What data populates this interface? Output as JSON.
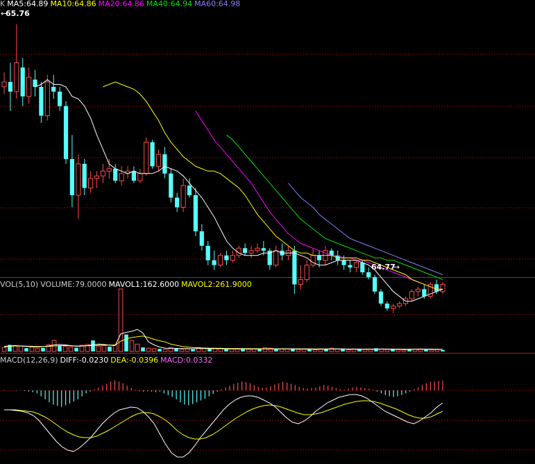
{
  "header": {
    "main_prefix": "K",
    "ma5": "MA5:64.89",
    "ma10": "MA10:64.86",
    "ma20": "MA20:64.86",
    "ma40": "MA40:64.94",
    "ma60": "MA60:64.98",
    "vol_title": "VOL(5,10)",
    "volume": "VOLUME:79.0000",
    "mavol1": "MAVOL1:162.6000",
    "mavol2": "MAVOL2:261.9000",
    "macd_title": "MACD(12,26,9)",
    "diff": "DIFF:-0.0230",
    "dea": "DEA:-0.0396",
    "macd": "MACD:0.0332"
  },
  "colors": {
    "background": "#000000",
    "up": "#ff4a4a",
    "down": "#54ffff",
    "ma5": "#ffffff",
    "ma10": "#ffff00",
    "ma20": "#ff00ff",
    "ma40": "#00e000",
    "ma60": "#8080ff",
    "grid": "#8b0000",
    "separator": "#b22222"
  },
  "chart_data": [
    {
      "type": "candlestick",
      "name": "price",
      "annotations": {
        "high": "65.76",
        "low": "64.77"
      },
      "ylim": [
        64.73,
        65.82
      ],
      "ohlc": [
        [
          65.5,
          65.56,
          65.47,
          65.52
        ],
        [
          65.52,
          65.6,
          65.4,
          65.48
        ],
        [
          65.48,
          65.76,
          65.45,
          65.6
        ],
        [
          65.58,
          65.62,
          65.42,
          65.46
        ],
        [
          65.46,
          65.58,
          65.43,
          65.54
        ],
        [
          65.53,
          65.57,
          65.46,
          65.5
        ],
        [
          65.5,
          65.52,
          65.35,
          65.38
        ],
        [
          65.38,
          65.55,
          65.36,
          65.52
        ],
        [
          65.5,
          65.55,
          65.45,
          65.48
        ],
        [
          65.48,
          65.5,
          65.4,
          65.42
        ],
        [
          65.42,
          65.44,
          65.18,
          65.2
        ],
        [
          65.2,
          65.3,
          65.0,
          65.05
        ],
        [
          65.05,
          65.22,
          64.95,
          65.18
        ],
        [
          65.18,
          65.2,
          65.05,
          65.08
        ],
        [
          65.08,
          65.15,
          65.06,
          65.12
        ],
        [
          65.12,
          65.15,
          65.08,
          65.13
        ],
        [
          65.13,
          65.18,
          65.1,
          65.15
        ],
        [
          65.15,
          65.2,
          65.12,
          65.16
        ],
        [
          65.16,
          65.18,
          65.1,
          65.11
        ],
        [
          65.11,
          65.17,
          65.09,
          65.14
        ],
        [
          65.14,
          65.17,
          65.12,
          65.15
        ],
        [
          65.15,
          65.17,
          65.1,
          65.11
        ],
        [
          65.11,
          65.16,
          65.1,
          65.14
        ],
        [
          65.14,
          65.29,
          65.13,
          65.27
        ],
        [
          65.27,
          65.28,
          65.16,
          65.17
        ],
        [
          65.17,
          65.24,
          65.15,
          65.22
        ],
        [
          65.22,
          65.25,
          65.12,
          65.14
        ],
        [
          65.14,
          65.16,
          65.02,
          65.04
        ],
        [
          65.04,
          65.06,
          64.98,
          65.0
        ],
        [
          65.0,
          65.12,
          64.98,
          65.09
        ],
        [
          65.09,
          65.12,
          65.04,
          65.05
        ],
        [
          65.05,
          65.08,
          64.88,
          64.9
        ],
        [
          64.9,
          64.93,
          64.82,
          64.84
        ],
        [
          64.84,
          64.86,
          64.76,
          64.78
        ],
        [
          64.78,
          64.82,
          64.74,
          64.76
        ],
        [
          64.76,
          64.81,
          64.75,
          64.8
        ],
        [
          64.8,
          64.82,
          64.76,
          64.78
        ],
        [
          64.78,
          64.82,
          64.77,
          64.8
        ],
        [
          64.8,
          64.84,
          64.79,
          64.83
        ],
        [
          64.83,
          64.85,
          64.8,
          64.81
        ],
        [
          64.81,
          64.84,
          64.79,
          64.82
        ],
        [
          64.82,
          64.85,
          64.81,
          64.83
        ],
        [
          64.83,
          64.86,
          64.8,
          64.82
        ],
        [
          64.82,
          64.83,
          64.74,
          64.76
        ],
        [
          64.76,
          64.84,
          64.75,
          64.82
        ],
        [
          64.82,
          64.85,
          64.78,
          64.8
        ],
        [
          64.8,
          64.84,
          64.78,
          64.82
        ],
        [
          64.82,
          64.84,
          64.64,
          64.68
        ],
        [
          64.68,
          64.76,
          64.66,
          64.7
        ],
        [
          64.7,
          64.78,
          64.69,
          64.76
        ],
        [
          64.76,
          64.83,
          64.75,
          64.8
        ],
        [
          64.8,
          64.82,
          64.75,
          64.78
        ],
        [
          64.78,
          64.84,
          64.76,
          64.82
        ],
        [
          64.82,
          64.83,
          64.78,
          64.8
        ],
        [
          64.8,
          64.82,
          64.76,
          64.78
        ],
        [
          64.78,
          64.8,
          64.74,
          64.76
        ],
        [
          64.76,
          64.78,
          64.73,
          64.75
        ],
        [
          64.75,
          64.78,
          64.73,
          64.77
        ],
        [
          64.77,
          64.78,
          64.72,
          64.73
        ],
        [
          64.73,
          64.75,
          64.7,
          64.71
        ],
        [
          64.71,
          64.72,
          64.64,
          64.65
        ],
        [
          64.65,
          64.66,
          64.59,
          64.6
        ],
        [
          64.6,
          64.61,
          64.57,
          64.58
        ],
        [
          64.58,
          64.6,
          64.56,
          64.59
        ],
        [
          64.59,
          64.61,
          64.58,
          64.6
        ],
        [
          64.6,
          64.63,
          64.59,
          64.62
        ],
        [
          64.62,
          64.66,
          64.61,
          64.65
        ],
        [
          64.65,
          64.67,
          64.63,
          64.66
        ],
        [
          64.66,
          64.68,
          64.62,
          64.63
        ],
        [
          64.63,
          64.69,
          64.62,
          64.68
        ],
        [
          64.68,
          64.7,
          64.64,
          64.65
        ],
        [
          64.65,
          64.69,
          64.64,
          64.68
        ]
      ],
      "ma5": [
        65.5,
        65.51,
        65.53,
        65.51,
        65.51,
        65.5,
        65.46,
        65.45,
        65.42,
        65.37,
        65.3,
        65.24,
        65.18,
        65.16,
        65.15,
        65.14,
        65.15,
        65.14,
        65.14,
        65.14,
        65.15,
        65.17,
        65.16,
        65.15,
        65.13,
        65.1,
        65.07,
        65.04,
        65.0,
        64.96,
        64.91,
        64.86,
        64.83,
        64.81,
        64.8,
        64.8,
        64.8,
        64.81,
        64.81,
        64.82,
        64.81,
        64.81,
        64.81,
        64.8,
        64.79,
        64.77,
        64.76,
        64.76,
        64.77,
        64.78,
        64.78,
        64.78,
        64.78,
        64.77,
        64.76,
        64.74,
        64.71,
        64.68,
        64.65,
        64.63,
        64.61,
        64.61,
        64.62,
        64.63,
        64.64,
        64.65,
        64.66
      ],
      "ma10": [
        65.5,
        65.51,
        65.52,
        65.51,
        65.5,
        65.49,
        65.47,
        65.44,
        65.4,
        65.36,
        65.31,
        65.27,
        65.24,
        65.21,
        65.19,
        65.17,
        65.16,
        65.15,
        65.15,
        65.14,
        65.12,
        65.1,
        65.08,
        65.05,
        65.01,
        64.97,
        64.94,
        64.91,
        64.88,
        64.86,
        64.84,
        64.82,
        64.81,
        64.81,
        64.8,
        64.8,
        64.8,
        64.8,
        64.79,
        64.79,
        64.79,
        64.79,
        64.78,
        64.78,
        64.77,
        64.76,
        64.75,
        64.74,
        64.73,
        64.72,
        64.7,
        64.69,
        64.68,
        64.67,
        64.66,
        64.66
      ],
      "ma20": [
        65.4,
        65.36,
        65.32,
        65.28,
        65.25,
        65.22,
        65.19,
        65.16,
        65.13,
        65.1,
        65.06,
        65.02,
        64.98,
        64.95,
        64.92,
        64.89,
        64.87,
        64.85,
        64.84,
        64.83,
        64.82,
        64.81,
        64.8,
        64.8,
        64.79,
        64.79,
        64.78,
        64.78,
        64.77,
        64.76,
        64.75,
        64.74,
        64.73,
        64.72,
        64.71,
        64.7,
        64.69,
        64.68,
        64.67,
        64.66,
        64.66
      ],
      "ma40": [
        65.3,
        65.28,
        65.25,
        65.22,
        65.19,
        65.16,
        65.13,
        65.1,
        65.07,
        65.04,
        65.01,
        64.98,
        64.95,
        64.93,
        64.91,
        64.89,
        64.87,
        64.86,
        64.85,
        64.84,
        64.83,
        64.82,
        64.81,
        64.8,
        64.79,
        64.79,
        64.78,
        64.78,
        64.77,
        64.76,
        64.75,
        64.74,
        64.73,
        64.72,
        64.71,
        64.7
      ],
      "ma60": [
        65.1,
        65.07,
        65.04,
        65.02,
        65.0,
        64.97,
        64.95,
        64.93,
        64.91,
        64.89,
        64.87,
        64.86,
        64.85,
        64.84,
        64.83,
        64.82,
        64.81,
        64.8,
        64.79,
        64.78,
        64.77,
        64.76,
        64.75,
        64.74,
        64.73,
        64.72
      ]
    },
    {
      "type": "bar",
      "name": "volume",
      "ylim": [
        0,
        1700
      ],
      "values": [
        110,
        180,
        160,
        150,
        90,
        120,
        80,
        95,
        180,
        300,
        160,
        140,
        120,
        100,
        170,
        190,
        300,
        150,
        160,
        130,
        180,
        1700,
        460,
        300,
        200,
        110,
        90,
        80,
        70,
        60,
        110,
        90,
        60,
        70,
        60,
        110,
        80,
        70,
        75,
        90,
        60,
        70,
        65,
        80,
        60,
        70,
        55,
        100,
        90,
        60,
        70,
        75,
        80,
        55,
        65,
        60,
        45,
        70,
        80,
        90,
        70,
        60,
        50,
        70,
        60,
        55,
        60,
        85,
        70,
        55,
        60,
        50,
        40,
        55,
        60,
        70,
        50,
        45,
        50,
        40
      ],
      "mavol1": [
        140,
        150,
        160,
        150,
        140,
        130,
        120,
        130,
        150,
        180,
        190,
        180,
        160,
        140,
        150,
        160,
        180,
        200,
        190,
        170,
        160,
        480,
        520,
        550,
        600,
        500,
        260,
        180,
        120,
        90,
        85,
        80,
        80,
        80,
        75,
        80,
        80,
        78,
        76,
        75,
        72,
        70,
        70,
        70,
        68,
        68,
        66,
        70,
        72,
        70,
        68,
        70,
        72,
        68,
        65,
        64,
        62,
        63,
        65,
        68,
        70,
        68,
        65,
        62,
        60,
        60,
        62,
        64,
        66,
        64,
        62,
        60,
        58,
        56,
        58,
        60,
        62,
        60,
        58,
        56
      ],
      "mavol2": [
        130,
        140,
        150,
        150,
        145,
        140,
        135,
        135,
        140,
        150,
        160,
        160,
        155,
        150,
        150,
        155,
        160,
        170,
        175,
        175,
        175,
        280,
        340,
        380,
        400,
        420,
        380,
        330,
        290,
        260,
        200,
        170,
        140,
        120,
        110,
        100,
        95,
        90,
        88,
        85,
        84,
        82,
        80,
        78,
        77,
        76,
        75,
        74,
        74,
        73,
        72,
        72,
        71,
        71,
        70,
        69,
        68,
        68,
        68,
        68,
        68,
        68,
        67,
        66,
        65,
        65,
        65,
        65,
        65,
        64,
        64,
        63,
        62,
        62,
        61,
        61,
        60,
        60,
        59,
        58
      ]
    },
    {
      "type": "macd",
      "name": "macd",
      "ylim": [
        -0.08,
        0.08
      ],
      "macd": [
        0.002,
        0.001,
        0.0,
        -0.001,
        0.0,
        -0.002,
        -0.004,
        -0.006,
        -0.01,
        -0.02,
        -0.03,
        -0.04,
        -0.048,
        -0.052,
        -0.055,
        -0.05,
        -0.044,
        -0.038,
        -0.03,
        -0.02,
        -0.01,
        -0.004,
        0.004,
        0.01,
        0.016,
        0.022,
        0.03,
        0.034,
        0.03,
        0.024,
        0.016,
        0.008,
        0.002,
        -0.002,
        -0.004,
        -0.003,
        -0.004,
        -0.006,
        -0.004,
        -0.01,
        -0.016,
        -0.022,
        -0.03,
        -0.04,
        -0.048,
        -0.05,
        -0.046,
        -0.04,
        -0.034,
        -0.028,
        -0.02,
        -0.012,
        -0.004,
        0.004,
        0.01,
        0.016,
        0.022,
        0.026,
        0.03,
        0.028,
        0.024,
        0.018,
        0.012,
        0.008,
        0.01,
        0.014,
        0.02,
        0.024,
        0.028,
        0.026,
        0.022,
        0.018,
        0.012,
        0.008,
        0.006,
        0.008,
        0.01,
        0.014,
        0.018,
        0.016,
        0.012,
        0.008,
        0.004,
        0.002,
        0.006,
        0.01,
        0.012,
        0.01,
        0.008,
        0.006,
        0.002,
        -0.004,
        -0.01,
        -0.016,
        -0.02,
        -0.022,
        -0.02,
        -0.016,
        -0.01,
        -0.004,
        0.004,
        0.01,
        0.018,
        0.024,
        0.028,
        0.03,
        0.032,
        0.033
      ],
      "diff": [
        0.0,
        0.0,
        -0.001,
        -0.002,
        -0.004,
        -0.008,
        -0.015,
        -0.025,
        -0.035,
        -0.045,
        -0.053,
        -0.058,
        -0.06,
        -0.055,
        -0.048,
        -0.04,
        -0.03,
        -0.02,
        -0.012,
        -0.005,
        0.0,
        0.002,
        0.004,
        0.003,
        -0.002,
        -0.01,
        -0.02,
        -0.035,
        -0.05,
        -0.062,
        -0.068,
        -0.068,
        -0.062,
        -0.052,
        -0.04,
        -0.03,
        -0.02,
        -0.01,
        0.0,
        0.008,
        0.014,
        0.018,
        0.02,
        0.02,
        0.018,
        0.014,
        0.01,
        0.004,
        -0.004,
        -0.012,
        -0.018,
        -0.02,
        -0.016,
        -0.01,
        -0.002,
        0.004,
        0.01,
        0.014,
        0.018,
        0.02,
        0.022,
        0.022,
        0.02,
        0.016,
        0.01,
        0.004,
        -0.002,
        -0.006,
        -0.01,
        -0.014,
        -0.018,
        -0.02,
        -0.016,
        -0.01,
        -0.004,
        0.004,
        0.01
      ],
      "dea": [
        0.0,
        0.0,
        0.0,
        -0.001,
        -0.002,
        -0.003,
        -0.006,
        -0.01,
        -0.015,
        -0.021,
        -0.027,
        -0.032,
        -0.036,
        -0.039,
        -0.04,
        -0.04,
        -0.038,
        -0.034,
        -0.03,
        -0.025,
        -0.02,
        -0.015,
        -0.01,
        -0.006,
        -0.004,
        -0.004,
        -0.006,
        -0.01,
        -0.015,
        -0.022,
        -0.03,
        -0.036,
        -0.04,
        -0.042,
        -0.042,
        -0.04,
        -0.036,
        -0.031,
        -0.025,
        -0.019,
        -0.013,
        -0.008,
        -0.003,
        0.001,
        0.004,
        0.006,
        0.007,
        0.006,
        0.004,
        0.001,
        -0.002,
        -0.005,
        -0.007,
        -0.007,
        -0.006,
        -0.004,
        -0.001,
        0.002,
        0.005,
        0.008,
        0.01,
        0.012,
        0.013,
        0.013,
        0.012,
        0.01,
        0.007,
        0.004,
        0.001,
        -0.003,
        -0.007,
        -0.01,
        -0.012,
        -0.012,
        -0.01,
        -0.006,
        -0.002
      ]
    }
  ]
}
